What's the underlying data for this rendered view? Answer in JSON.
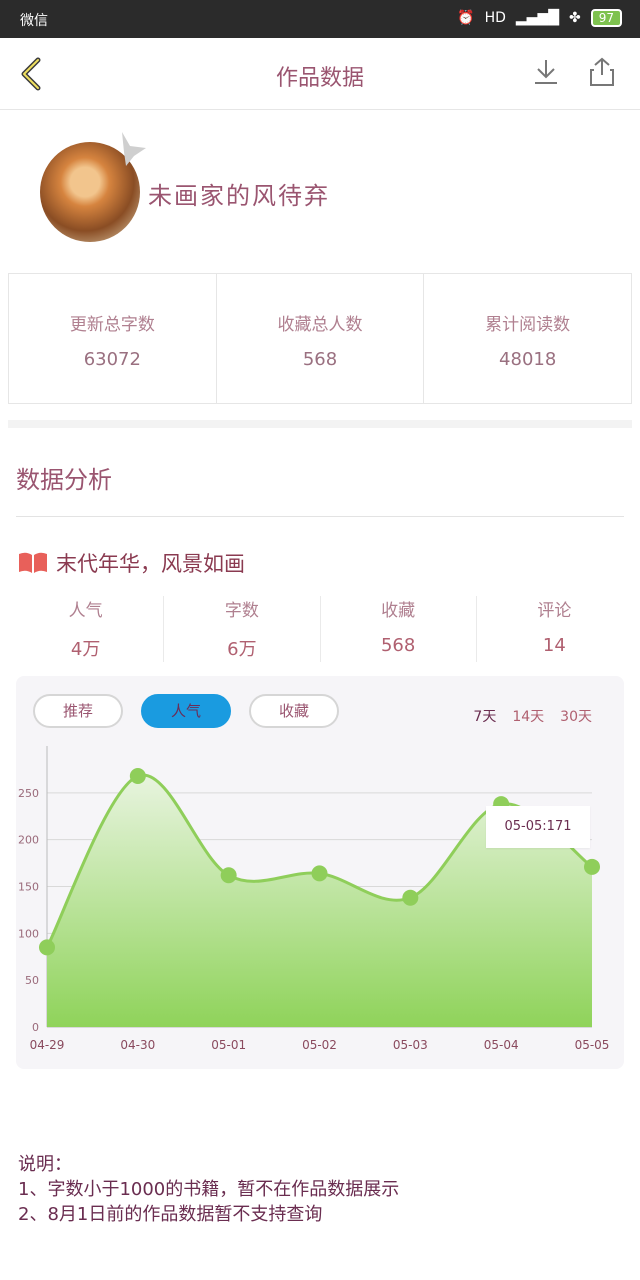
{
  "status_bar": {
    "left_text": "微信",
    "signal_text": "HD",
    "battery": "97"
  },
  "header": {
    "title": "作品数据"
  },
  "profile": {
    "name": "未画家的风待弃"
  },
  "summary": [
    {
      "label": "更新总字数",
      "value": "63072"
    },
    {
      "label": "收藏总人数",
      "value": "568"
    },
    {
      "label": "累计阅读数",
      "value": "48018"
    }
  ],
  "analysis": {
    "title": "数据分析"
  },
  "work": {
    "title": "末代年华，风景如画",
    "metrics": [
      {
        "label": "人气",
        "value": "4万"
      },
      {
        "label": "字数",
        "value": "6万"
      },
      {
        "label": "收藏",
        "value": "568"
      },
      {
        "label": "评论",
        "value": "14"
      }
    ]
  },
  "chart_tabs": [
    "推荐",
    "人气",
    "收藏"
  ],
  "chart_ranges": [
    "7天",
    "14天",
    "30天"
  ],
  "tooltip": "05-05:171",
  "chart_data": {
    "type": "area",
    "categories": [
      "04-29",
      "04-30",
      "05-01",
      "05-02",
      "05-03",
      "05-04",
      "05-05"
    ],
    "values": [
      85,
      268,
      162,
      164,
      138,
      238,
      171
    ],
    "ylim": [
      0,
      300
    ],
    "yticks": [
      0,
      50,
      100,
      150,
      200,
      250
    ],
    "grid": true,
    "color": "#8fce5a"
  },
  "notes": {
    "title": "说明：",
    "line1": "1、字数小于1000的书籍，暂不在作品数据展示",
    "line2": "2、8月1日前的作品数据暂不支持查询"
  }
}
